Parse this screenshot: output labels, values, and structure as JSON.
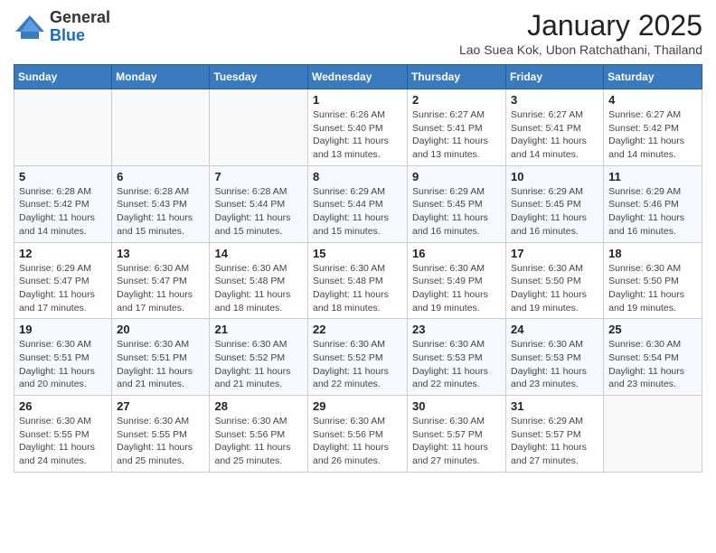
{
  "header": {
    "logo": {
      "general": "General",
      "blue": "Blue"
    },
    "month": "January 2025",
    "location": "Lao Suea Kok, Ubon Ratchathani, Thailand"
  },
  "weekdays": [
    "Sunday",
    "Monday",
    "Tuesday",
    "Wednesday",
    "Thursday",
    "Friday",
    "Saturday"
  ],
  "weeks": [
    [
      {
        "day": "",
        "info": ""
      },
      {
        "day": "",
        "info": ""
      },
      {
        "day": "",
        "info": ""
      },
      {
        "day": "1",
        "info": "Sunrise: 6:26 AM\nSunset: 5:40 PM\nDaylight: 11 hours and 13 minutes."
      },
      {
        "day": "2",
        "info": "Sunrise: 6:27 AM\nSunset: 5:41 PM\nDaylight: 11 hours and 13 minutes."
      },
      {
        "day": "3",
        "info": "Sunrise: 6:27 AM\nSunset: 5:41 PM\nDaylight: 11 hours and 14 minutes."
      },
      {
        "day": "4",
        "info": "Sunrise: 6:27 AM\nSunset: 5:42 PM\nDaylight: 11 hours and 14 minutes."
      }
    ],
    [
      {
        "day": "5",
        "info": "Sunrise: 6:28 AM\nSunset: 5:42 PM\nDaylight: 11 hours and 14 minutes."
      },
      {
        "day": "6",
        "info": "Sunrise: 6:28 AM\nSunset: 5:43 PM\nDaylight: 11 hours and 15 minutes."
      },
      {
        "day": "7",
        "info": "Sunrise: 6:28 AM\nSunset: 5:44 PM\nDaylight: 11 hours and 15 minutes."
      },
      {
        "day": "8",
        "info": "Sunrise: 6:29 AM\nSunset: 5:44 PM\nDaylight: 11 hours and 15 minutes."
      },
      {
        "day": "9",
        "info": "Sunrise: 6:29 AM\nSunset: 5:45 PM\nDaylight: 11 hours and 16 minutes."
      },
      {
        "day": "10",
        "info": "Sunrise: 6:29 AM\nSunset: 5:45 PM\nDaylight: 11 hours and 16 minutes."
      },
      {
        "day": "11",
        "info": "Sunrise: 6:29 AM\nSunset: 5:46 PM\nDaylight: 11 hours and 16 minutes."
      }
    ],
    [
      {
        "day": "12",
        "info": "Sunrise: 6:29 AM\nSunset: 5:47 PM\nDaylight: 11 hours and 17 minutes."
      },
      {
        "day": "13",
        "info": "Sunrise: 6:30 AM\nSunset: 5:47 PM\nDaylight: 11 hours and 17 minutes."
      },
      {
        "day": "14",
        "info": "Sunrise: 6:30 AM\nSunset: 5:48 PM\nDaylight: 11 hours and 18 minutes."
      },
      {
        "day": "15",
        "info": "Sunrise: 6:30 AM\nSunset: 5:48 PM\nDaylight: 11 hours and 18 minutes."
      },
      {
        "day": "16",
        "info": "Sunrise: 6:30 AM\nSunset: 5:49 PM\nDaylight: 11 hours and 19 minutes."
      },
      {
        "day": "17",
        "info": "Sunrise: 6:30 AM\nSunset: 5:50 PM\nDaylight: 11 hours and 19 minutes."
      },
      {
        "day": "18",
        "info": "Sunrise: 6:30 AM\nSunset: 5:50 PM\nDaylight: 11 hours and 19 minutes."
      }
    ],
    [
      {
        "day": "19",
        "info": "Sunrise: 6:30 AM\nSunset: 5:51 PM\nDaylight: 11 hours and 20 minutes."
      },
      {
        "day": "20",
        "info": "Sunrise: 6:30 AM\nSunset: 5:51 PM\nDaylight: 11 hours and 21 minutes."
      },
      {
        "day": "21",
        "info": "Sunrise: 6:30 AM\nSunset: 5:52 PM\nDaylight: 11 hours and 21 minutes."
      },
      {
        "day": "22",
        "info": "Sunrise: 6:30 AM\nSunset: 5:52 PM\nDaylight: 11 hours and 22 minutes."
      },
      {
        "day": "23",
        "info": "Sunrise: 6:30 AM\nSunset: 5:53 PM\nDaylight: 11 hours and 22 minutes."
      },
      {
        "day": "24",
        "info": "Sunrise: 6:30 AM\nSunset: 5:53 PM\nDaylight: 11 hours and 23 minutes."
      },
      {
        "day": "25",
        "info": "Sunrise: 6:30 AM\nSunset: 5:54 PM\nDaylight: 11 hours and 23 minutes."
      }
    ],
    [
      {
        "day": "26",
        "info": "Sunrise: 6:30 AM\nSunset: 5:55 PM\nDaylight: 11 hours and 24 minutes."
      },
      {
        "day": "27",
        "info": "Sunrise: 6:30 AM\nSunset: 5:55 PM\nDaylight: 11 hours and 25 minutes."
      },
      {
        "day": "28",
        "info": "Sunrise: 6:30 AM\nSunset: 5:56 PM\nDaylight: 11 hours and 25 minutes."
      },
      {
        "day": "29",
        "info": "Sunrise: 6:30 AM\nSunset: 5:56 PM\nDaylight: 11 hours and 26 minutes."
      },
      {
        "day": "30",
        "info": "Sunrise: 6:30 AM\nSunset: 5:57 PM\nDaylight: 11 hours and 27 minutes."
      },
      {
        "day": "31",
        "info": "Sunrise: 6:29 AM\nSunset: 5:57 PM\nDaylight: 11 hours and 27 minutes."
      },
      {
        "day": "",
        "info": ""
      }
    ]
  ]
}
